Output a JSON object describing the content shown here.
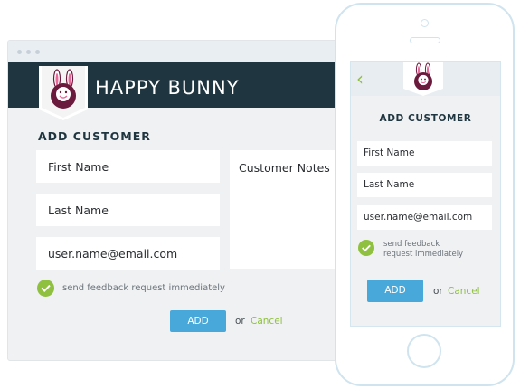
{
  "brand": {
    "name": "HAPPY BUNNY",
    "badge_text": "HAPPY BUNNY"
  },
  "form": {
    "title": "ADD CUSTOMER",
    "first_name_placeholder": "First Name",
    "last_name_placeholder": "Last Name",
    "email_value": "user.name@email.com",
    "notes_placeholder": "Customer Notes",
    "feedback_label": "send feedback request immediately",
    "feedback_checked": true,
    "add_label": "ADD",
    "or_label": "or",
    "cancel_label": "Cancel"
  },
  "mobile": {
    "back_icon": "chevron-left-icon",
    "feedback_line1": "send feedback",
    "feedback_line2": "request immediately"
  },
  "colors": {
    "header": "#1f3540",
    "accent_blue": "#48a8d9",
    "accent_green": "#8fc03f",
    "badge_purple": "#6a1a3c"
  }
}
